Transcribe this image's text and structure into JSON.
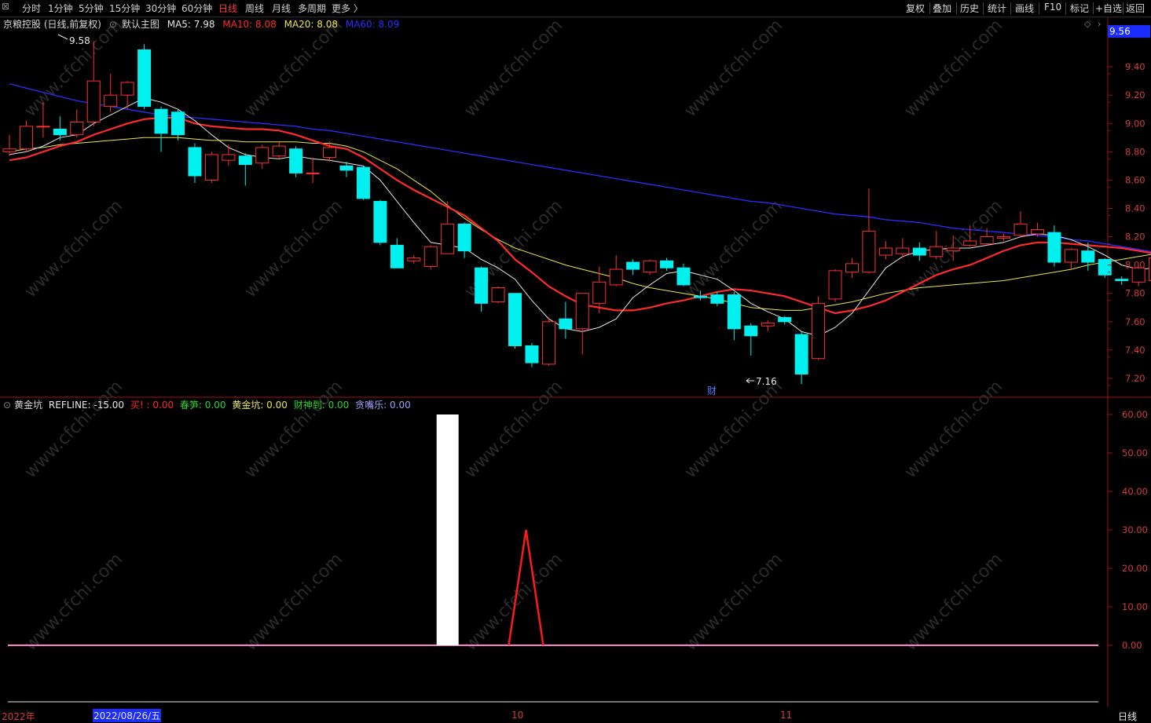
{
  "toolbar": {
    "periods": [
      "分时",
      "1分钟",
      "5分钟",
      "15分钟",
      "30分钟",
      "60分钟",
      "日线",
      "周线",
      "月线",
      "多周期",
      "更多 〉"
    ],
    "active_period": "日线",
    "right_buttons": [
      "复权",
      "叠加",
      "历史",
      "统计",
      "画线",
      "F10",
      "标记",
      "+自选",
      "返回"
    ]
  },
  "main_panel": {
    "stock_title": "京粮控股 (日线,前复权)",
    "chart_name": "默认主图",
    "ma": [
      {
        "label": "MA5: 7.98",
        "color": "#e6e6e6"
      },
      {
        "label": "MA10: 8.08",
        "color": "#ff2b2b"
      },
      {
        "label": "MA20: 8.08",
        "color": "#e8e84a"
      },
      {
        "label": "MA60: 8.09",
        "color": "#2c2cff"
      }
    ],
    "current_price_tag": "9.56",
    "high_label": "9.58",
    "low_label": "7.16",
    "event_marker": "财",
    "y_ticks": [
      "9.40",
      "9.20",
      "9.00",
      "8.80",
      "8.60",
      "8.40",
      "8.20",
      "8.00",
      "7.80",
      "7.60",
      "7.40",
      "7.20"
    ]
  },
  "sub_panel": {
    "indicator_name": "黄金坑",
    "items": [
      {
        "label": "REFLINE: -15.00",
        "color": "#e6e6e6"
      },
      {
        "label": "买! : 0.00",
        "color": "#ff2b2b"
      },
      {
        "label": "春笋: 0.00",
        "color": "#2bd42b"
      },
      {
        "label": "黄金坑: 0.00",
        "color": "#e8e84a"
      },
      {
        "label": "财神到: 0.00",
        "color": "#2bd42b"
      },
      {
        "label": "贪嘴乐: 0.00",
        "color": "#a0a0ff"
      }
    ],
    "y_ticks": [
      "60.00",
      "50.00",
      "40.00",
      "30.00",
      "20.00",
      "10.00",
      "0.00"
    ]
  },
  "bottom_bar": {
    "year_label": "2022年",
    "cursor_date": "2022/08/26/五",
    "month_labels": [
      "10",
      "11"
    ],
    "period_label": "日线"
  },
  "watermark": "www.cfchi.com",
  "chart_data": {
    "type": "candlestick",
    "ylim": [
      7.1,
      9.65
    ],
    "candles": [
      {
        "o": 8.8,
        "c": 8.82,
        "h": 8.92,
        "l": 8.77
      },
      {
        "o": 8.82,
        "c": 8.98,
        "h": 9.02,
        "l": 8.8
      },
      {
        "o": 8.98,
        "c": 8.98,
        "h": 9.15,
        "l": 8.9
      },
      {
        "o": 8.96,
        "c": 8.92,
        "h": 9.05,
        "l": 8.88
      },
      {
        "o": 8.92,
        "c": 9.01,
        "h": 9.1,
        "l": 8.9
      },
      {
        "o": 9.01,
        "c": 9.3,
        "h": 9.58,
        "l": 8.98
      },
      {
        "o": 9.12,
        "c": 9.2,
        "h": 9.35,
        "l": 9.08
      },
      {
        "o": 9.2,
        "c": 9.29,
        "h": 9.3,
        "l": 9.1
      },
      {
        "o": 9.52,
        "c": 9.12,
        "h": 9.56,
        "l": 9.1
      },
      {
        "o": 9.1,
        "c": 8.93,
        "h": 9.12,
        "l": 8.8
      },
      {
        "o": 9.08,
        "c": 8.92,
        "h": 9.1,
        "l": 8.88
      },
      {
        "o": 8.83,
        "c": 8.63,
        "h": 8.86,
        "l": 8.58
      },
      {
        "o": 8.6,
        "c": 8.78,
        "h": 8.8,
        "l": 8.58
      },
      {
        "o": 8.74,
        "c": 8.78,
        "h": 8.85,
        "l": 8.7
      },
      {
        "o": 8.77,
        "c": 8.71,
        "h": 8.79,
        "l": 8.56
      },
      {
        "o": 8.72,
        "c": 8.83,
        "h": 8.85,
        "l": 8.68
      },
      {
        "o": 8.77,
        "c": 8.84,
        "h": 8.87,
        "l": 8.75
      },
      {
        "o": 8.82,
        "c": 8.65,
        "h": 8.84,
        "l": 8.62
      },
      {
        "o": 8.65,
        "c": 8.65,
        "h": 8.76,
        "l": 8.58
      },
      {
        "o": 8.76,
        "c": 8.83,
        "h": 8.87,
        "l": 8.73
      },
      {
        "o": 8.7,
        "c": 8.67,
        "h": 8.73,
        "l": 8.62
      },
      {
        "o": 8.69,
        "c": 8.47,
        "h": 8.7,
        "l": 8.46
      },
      {
        "o": 8.45,
        "c": 8.16,
        "h": 8.46,
        "l": 8.14
      },
      {
        "o": 8.14,
        "c": 7.98,
        "h": 8.19,
        "l": 7.98
      },
      {
        "o": 8.03,
        "c": 8.05,
        "h": 8.07,
        "l": 8.01
      },
      {
        "o": 7.99,
        "c": 8.13,
        "h": 8.14,
        "l": 7.97
      },
      {
        "o": 8.08,
        "c": 8.29,
        "h": 8.45,
        "l": 8.08
      },
      {
        "o": 8.29,
        "c": 8.1,
        "h": 8.3,
        "l": 8.05
      },
      {
        "o": 7.98,
        "c": 7.73,
        "h": 7.99,
        "l": 7.67
      },
      {
        "o": 7.74,
        "c": 7.84,
        "h": 7.85,
        "l": 7.73
      },
      {
        "o": 7.8,
        "c": 7.43,
        "h": 7.8,
        "l": 7.41
      },
      {
        "o": 7.43,
        "c": 7.31,
        "h": 7.45,
        "l": 7.28
      },
      {
        "o": 7.3,
        "c": 7.6,
        "h": 7.63,
        "l": 7.29
      },
      {
        "o": 7.62,
        "c": 7.55,
        "h": 7.74,
        "l": 7.48
      },
      {
        "o": 7.55,
        "c": 7.8,
        "h": 7.8,
        "l": 7.37
      },
      {
        "o": 7.73,
        "c": 7.88,
        "h": 7.99,
        "l": 7.66
      },
      {
        "o": 7.86,
        "c": 7.97,
        "h": 8.07,
        "l": 7.85
      },
      {
        "o": 8.02,
        "c": 7.97,
        "h": 8.04,
        "l": 7.93
      },
      {
        "o": 7.95,
        "c": 8.03,
        "h": 8.04,
        "l": 7.93
      },
      {
        "o": 8.03,
        "c": 7.98,
        "h": 8.05,
        "l": 7.96
      },
      {
        "o": 7.98,
        "c": 7.86,
        "h": 8.01,
        "l": 7.85
      },
      {
        "o": 7.78,
        "c": 7.77,
        "h": 7.82,
        "l": 7.75
      },
      {
        "o": 7.79,
        "c": 7.73,
        "h": 7.81,
        "l": 7.71
      },
      {
        "o": 7.79,
        "c": 7.55,
        "h": 7.81,
        "l": 7.47
      },
      {
        "o": 7.57,
        "c": 7.5,
        "h": 7.59,
        "l": 7.36
      },
      {
        "o": 7.57,
        "c": 7.59,
        "h": 7.61,
        "l": 7.53
      },
      {
        "o": 7.63,
        "c": 7.6,
        "h": 7.64,
        "l": 7.58
      },
      {
        "o": 7.51,
        "c": 7.23,
        "h": 7.53,
        "l": 7.16
      },
      {
        "o": 7.34,
        "c": 7.73,
        "h": 7.78,
        "l": 7.33
      },
      {
        "o": 7.76,
        "c": 7.96,
        "h": 7.97,
        "l": 7.74
      },
      {
        "o": 7.95,
        "c": 8.01,
        "h": 8.05,
        "l": 7.91
      },
      {
        "o": 7.95,
        "c": 8.24,
        "h": 8.54,
        "l": 7.94
      },
      {
        "o": 8.07,
        "c": 8.12,
        "h": 8.17,
        "l": 8.04
      },
      {
        "o": 8.08,
        "c": 8.12,
        "h": 8.19,
        "l": 8.05
      },
      {
        "o": 8.12,
        "c": 8.07,
        "h": 8.16,
        "l": 8.03
      },
      {
        "o": 8.06,
        "c": 8.13,
        "h": 8.24,
        "l": 8.04
      },
      {
        "o": 8.1,
        "c": 8.12,
        "h": 8.21,
        "l": 8.03
      },
      {
        "o": 8.14,
        "c": 8.17,
        "h": 8.28,
        "l": 8.13
      },
      {
        "o": 8.15,
        "c": 8.2,
        "h": 8.26,
        "l": 8.14
      },
      {
        "o": 8.19,
        "c": 8.2,
        "h": 8.22,
        "l": 8.17
      },
      {
        "o": 8.21,
        "c": 8.29,
        "h": 8.38,
        "l": 8.2
      },
      {
        "o": 8.22,
        "c": 8.25,
        "h": 8.3,
        "l": 8.2
      },
      {
        "o": 8.23,
        "c": 8.02,
        "h": 8.28,
        "l": 7.99
      },
      {
        "o": 8.02,
        "c": 8.11,
        "h": 8.12,
        "l": 7.97
      },
      {
        "o": 8.1,
        "c": 8.02,
        "h": 8.16,
        "l": 7.96
      },
      {
        "o": 8.04,
        "c": 7.93,
        "h": 8.05,
        "l": 7.91
      },
      {
        "o": 7.9,
        "c": 7.89,
        "h": 7.92,
        "l": 7.86
      },
      {
        "o": 7.88,
        "c": 7.98,
        "h": 7.99,
        "l": 7.85
      },
      {
        "o": 7.89,
        "c": 8.05,
        "h": 8.07,
        "l": 7.88
      }
    ],
    "ma5": [
      8.78,
      8.8,
      8.84,
      8.9,
      8.92,
      9.0,
      9.06,
      9.12,
      9.18,
      9.15,
      9.1,
      9.02,
      8.92,
      8.83,
      8.78,
      8.76,
      8.75,
      8.77,
      8.75,
      8.74,
      8.72,
      8.7,
      8.6,
      8.45,
      8.3,
      8.16,
      8.14,
      8.12,
      8.04,
      7.98,
      7.9,
      7.75,
      7.62,
      7.55,
      7.53,
      7.56,
      7.62,
      7.77,
      7.86,
      7.94,
      7.96,
      7.93,
      7.9,
      7.82,
      7.73,
      7.67,
      7.62,
      7.53,
      7.5,
      7.56,
      7.66,
      7.82,
      7.98,
      8.06,
      8.1,
      8.11,
      8.12,
      8.12,
      8.14,
      8.16,
      8.2,
      8.22,
      8.21,
      8.18,
      8.13,
      8.07,
      8.0,
      7.97,
      7.98
    ],
    "ma10": [
      8.74,
      8.76,
      8.8,
      8.84,
      8.87,
      8.92,
      8.96,
      9.0,
      9.03,
      9.04,
      9.04,
      9.0,
      8.98,
      8.97,
      8.96,
      8.96,
      8.95,
      8.92,
      8.88,
      8.84,
      8.82,
      8.76,
      8.68,
      8.6,
      8.53,
      8.47,
      8.41,
      8.35,
      8.26,
      8.17,
      8.04,
      7.95,
      7.85,
      7.78,
      7.72,
      7.7,
      7.68,
      7.68,
      7.7,
      7.73,
      7.75,
      7.78,
      7.81,
      7.83,
      7.82,
      7.8,
      7.78,
      7.74,
      7.7,
      7.66,
      7.68,
      7.71,
      7.75,
      7.81,
      7.87,
      7.93,
      7.97,
      8.0,
      8.05,
      8.1,
      8.14,
      8.16,
      8.16,
      8.15,
      8.14,
      8.13,
      8.12,
      8.1,
      8.08
    ],
    "ma20": [
      8.8,
      8.82,
      8.83,
      8.85,
      8.86,
      8.87,
      8.88,
      8.89,
      8.9,
      8.9,
      8.9,
      8.89,
      8.88,
      8.88,
      8.87,
      8.87,
      8.87,
      8.87,
      8.86,
      8.86,
      8.84,
      8.8,
      8.74,
      8.68,
      8.6,
      8.52,
      8.42,
      8.33,
      8.25,
      8.18,
      8.12,
      8.08,
      8.04,
      8.0,
      7.97,
      7.94,
      7.91,
      7.87,
      7.84,
      7.82,
      7.8,
      7.78,
      7.76,
      7.73,
      7.7,
      7.69,
      7.68,
      7.68,
      7.7,
      7.72,
      7.74,
      7.77,
      7.8,
      7.82,
      7.84,
      7.85,
      7.86,
      7.87,
      7.88,
      7.89,
      7.91,
      7.93,
      7.95,
      7.97,
      8.0,
      8.02,
      8.04,
      8.06,
      8.08
    ],
    "ma60": [
      9.28,
      9.25,
      9.22,
      9.19,
      9.16,
      9.14,
      9.12,
      9.1,
      9.08,
      9.06,
      9.05,
      9.04,
      9.03,
      9.02,
      9.01,
      9.0,
      8.99,
      8.98,
      8.96,
      8.95,
      8.93,
      8.91,
      8.89,
      8.87,
      8.85,
      8.83,
      8.81,
      8.79,
      8.77,
      8.75,
      8.73,
      8.71,
      8.69,
      8.67,
      8.65,
      8.63,
      8.61,
      8.59,
      8.57,
      8.55,
      8.53,
      8.51,
      8.49,
      8.47,
      8.45,
      8.44,
      8.42,
      8.4,
      8.38,
      8.36,
      8.35,
      8.34,
      8.32,
      8.31,
      8.3,
      8.28,
      8.26,
      8.25,
      8.24,
      8.23,
      8.22,
      8.21,
      8.2,
      8.18,
      8.17,
      8.15,
      8.13,
      8.11,
      8.09
    ],
    "indicator": {
      "ylim": [
        -15,
        60
      ],
      "bars": [
        {
          "index": 26,
          "value": 60
        }
      ],
      "spikes": [
        {
          "index": 30,
          "value": 30
        }
      ]
    }
  }
}
